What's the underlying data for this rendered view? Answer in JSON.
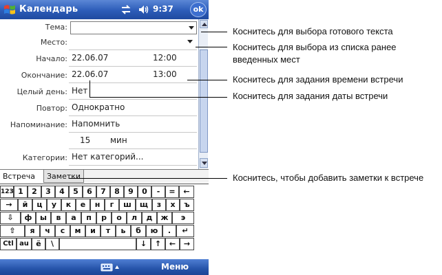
{
  "statusbar": {
    "app_title": "Календарь",
    "time": "9:37",
    "ok_label": "ok"
  },
  "form": {
    "rows": [
      {
        "label": "Тема:",
        "value": ""
      },
      {
        "label": "Место:",
        "value": ""
      },
      {
        "label": "Начало:",
        "value": "22.06.07",
        "value2": "12:00"
      },
      {
        "label": "Окончание:",
        "value": "22.06.07",
        "value2": "13:00"
      },
      {
        "label": "Целый день:",
        "value": "Нет"
      },
      {
        "label": "Повтор:",
        "value": "Однократно"
      },
      {
        "label": "Напоминание:",
        "value": "Напомнить"
      },
      {
        "label": "",
        "value": "15",
        "value2": "мин"
      },
      {
        "label": "Категории:",
        "value": "Нет категорий..."
      }
    ]
  },
  "tabs": [
    {
      "label": "Встреча"
    },
    {
      "label": "Заметки"
    }
  ],
  "keyboard": {
    "rows": [
      [
        "123",
        "1",
        "2",
        "3",
        "4",
        "5",
        "6",
        "7",
        "8",
        "9",
        "0",
        "-",
        "=",
        "←"
      ],
      [
        "→",
        "й",
        "ц",
        "у",
        "к",
        "е",
        "н",
        "г",
        "ш",
        "щ",
        "з",
        "х",
        "ъ"
      ],
      [
        "⇩",
        "ф",
        "ы",
        "в",
        "а",
        "п",
        "р",
        "о",
        "л",
        "д",
        "ж",
        "э"
      ],
      [
        "⇧",
        "я",
        "ч",
        "с",
        "м",
        "и",
        "т",
        "ь",
        "б",
        "ю",
        ".",
        "↵"
      ],
      [
        "Ctl",
        "au",
        "ё",
        "\\",
        "",
        "↓",
        "↑",
        "←",
        "→"
      ]
    ]
  },
  "menubar": {
    "menu_label": "Меню"
  },
  "callouts": [
    {
      "text": "Коснитесь для выбора готового текста"
    },
    {
      "text": "Коснитесь для выбора из списка ранее введенных мест"
    },
    {
      "text": "Коснитесь для задания времени встречи"
    },
    {
      "text": "Коснитесь для задания даты встречи"
    },
    {
      "text": "Коснитесь, чтобы добавить заметки к встрече"
    }
  ],
  "colors": {
    "title_bar": "#2c5cb8",
    "menu_bar": "#2654aa"
  }
}
